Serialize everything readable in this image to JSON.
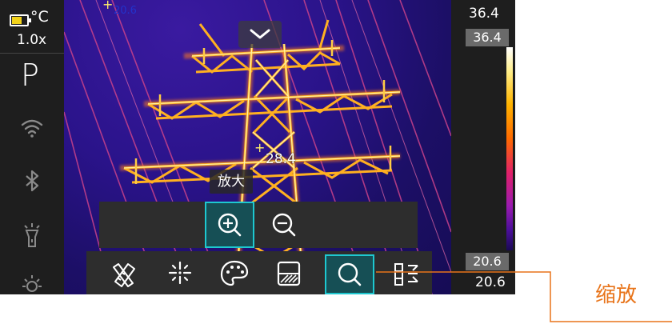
{
  "status": {
    "unit": "°C",
    "zoom_level": "1.0x",
    "mode": "P",
    "battery_level": 0.7
  },
  "sidebar_icons": [
    "wifi-icon",
    "bluetooth-icon",
    "flashlight-icon",
    "brightness-icon"
  ],
  "image": {
    "center_temp": "28.4",
    "top_label": "20.6",
    "tooltip": "放大"
  },
  "zoom_bar": {
    "buttons": [
      {
        "name": "zoom-in-button",
        "icon": "zoom-in-icon",
        "active": true
      },
      {
        "name": "zoom-out-button",
        "icon": "zoom-out-icon",
        "active": false
      }
    ]
  },
  "toolbar": {
    "buttons": [
      {
        "name": "measure-tool-button",
        "icon": "ruler-pencil-icon",
        "active": false
      },
      {
        "name": "spot-tool-button",
        "icon": "sparkle-icon",
        "active": false
      },
      {
        "name": "palette-button",
        "icon": "palette-icon",
        "active": false
      },
      {
        "name": "image-mode-button",
        "icon": "gradient-box-icon",
        "active": false
      },
      {
        "name": "zoom-button",
        "icon": "magnifier-icon",
        "active": true
      },
      {
        "name": "level-span-button",
        "icon": "level-icon",
        "active": false
      }
    ]
  },
  "scale": {
    "max_label": "36.4",
    "max_box": "36.4",
    "min_box": "20.6",
    "min_label": "20.6"
  },
  "callout": {
    "label": "缩放",
    "color": "#e8741a"
  },
  "colors": {
    "accent": "#1ec8d0",
    "highlight": "#ffef6a"
  }
}
